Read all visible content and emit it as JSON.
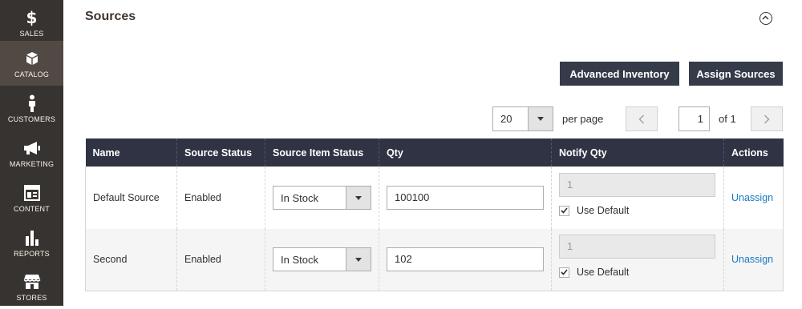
{
  "sidebar": {
    "items": [
      {
        "label": "SALES",
        "icon": "dollar-icon"
      },
      {
        "label": "CATALOG",
        "icon": "cube-icon"
      },
      {
        "label": "CUSTOMERS",
        "icon": "person-icon"
      },
      {
        "label": "MARKETING",
        "icon": "megaphone-icon"
      },
      {
        "label": "CONTENT",
        "icon": "layout-icon"
      },
      {
        "label": "REPORTS",
        "icon": "bar-chart-icon"
      },
      {
        "label": "STORES",
        "icon": "store-icon"
      }
    ],
    "active": "CATALOG"
  },
  "section": {
    "title": "Sources"
  },
  "actions": {
    "advanced_inventory": "Advanced Inventory",
    "assign_sources": "Assign Sources"
  },
  "pager": {
    "per_page_value": "20",
    "per_page_label": "per page",
    "current_page": "1",
    "of_label": "of 1"
  },
  "table": {
    "headers": [
      "Name",
      "Source Status",
      "Source Item Status",
      "Qty",
      "Notify Qty",
      "Actions"
    ],
    "rows": [
      {
        "name": "Default Source",
        "source_status": "Enabled",
        "item_status": "In Stock",
        "qty": "100100",
        "notify_qty": "1",
        "use_default_label": "Use Default",
        "use_default_checked": true,
        "action": "Unassign"
      },
      {
        "name": "Second",
        "source_status": "Enabled",
        "item_status": "In Stock",
        "qty": "102",
        "notify_qty": "1",
        "use_default_label": "Use Default",
        "use_default_checked": true,
        "action": "Unassign"
      }
    ]
  },
  "colors": {
    "sidebar_bg": "#373330",
    "sidebar_active": "#514943",
    "header_bg": "#2f3343",
    "button_bg": "#363b4a",
    "link": "#1979c3"
  }
}
